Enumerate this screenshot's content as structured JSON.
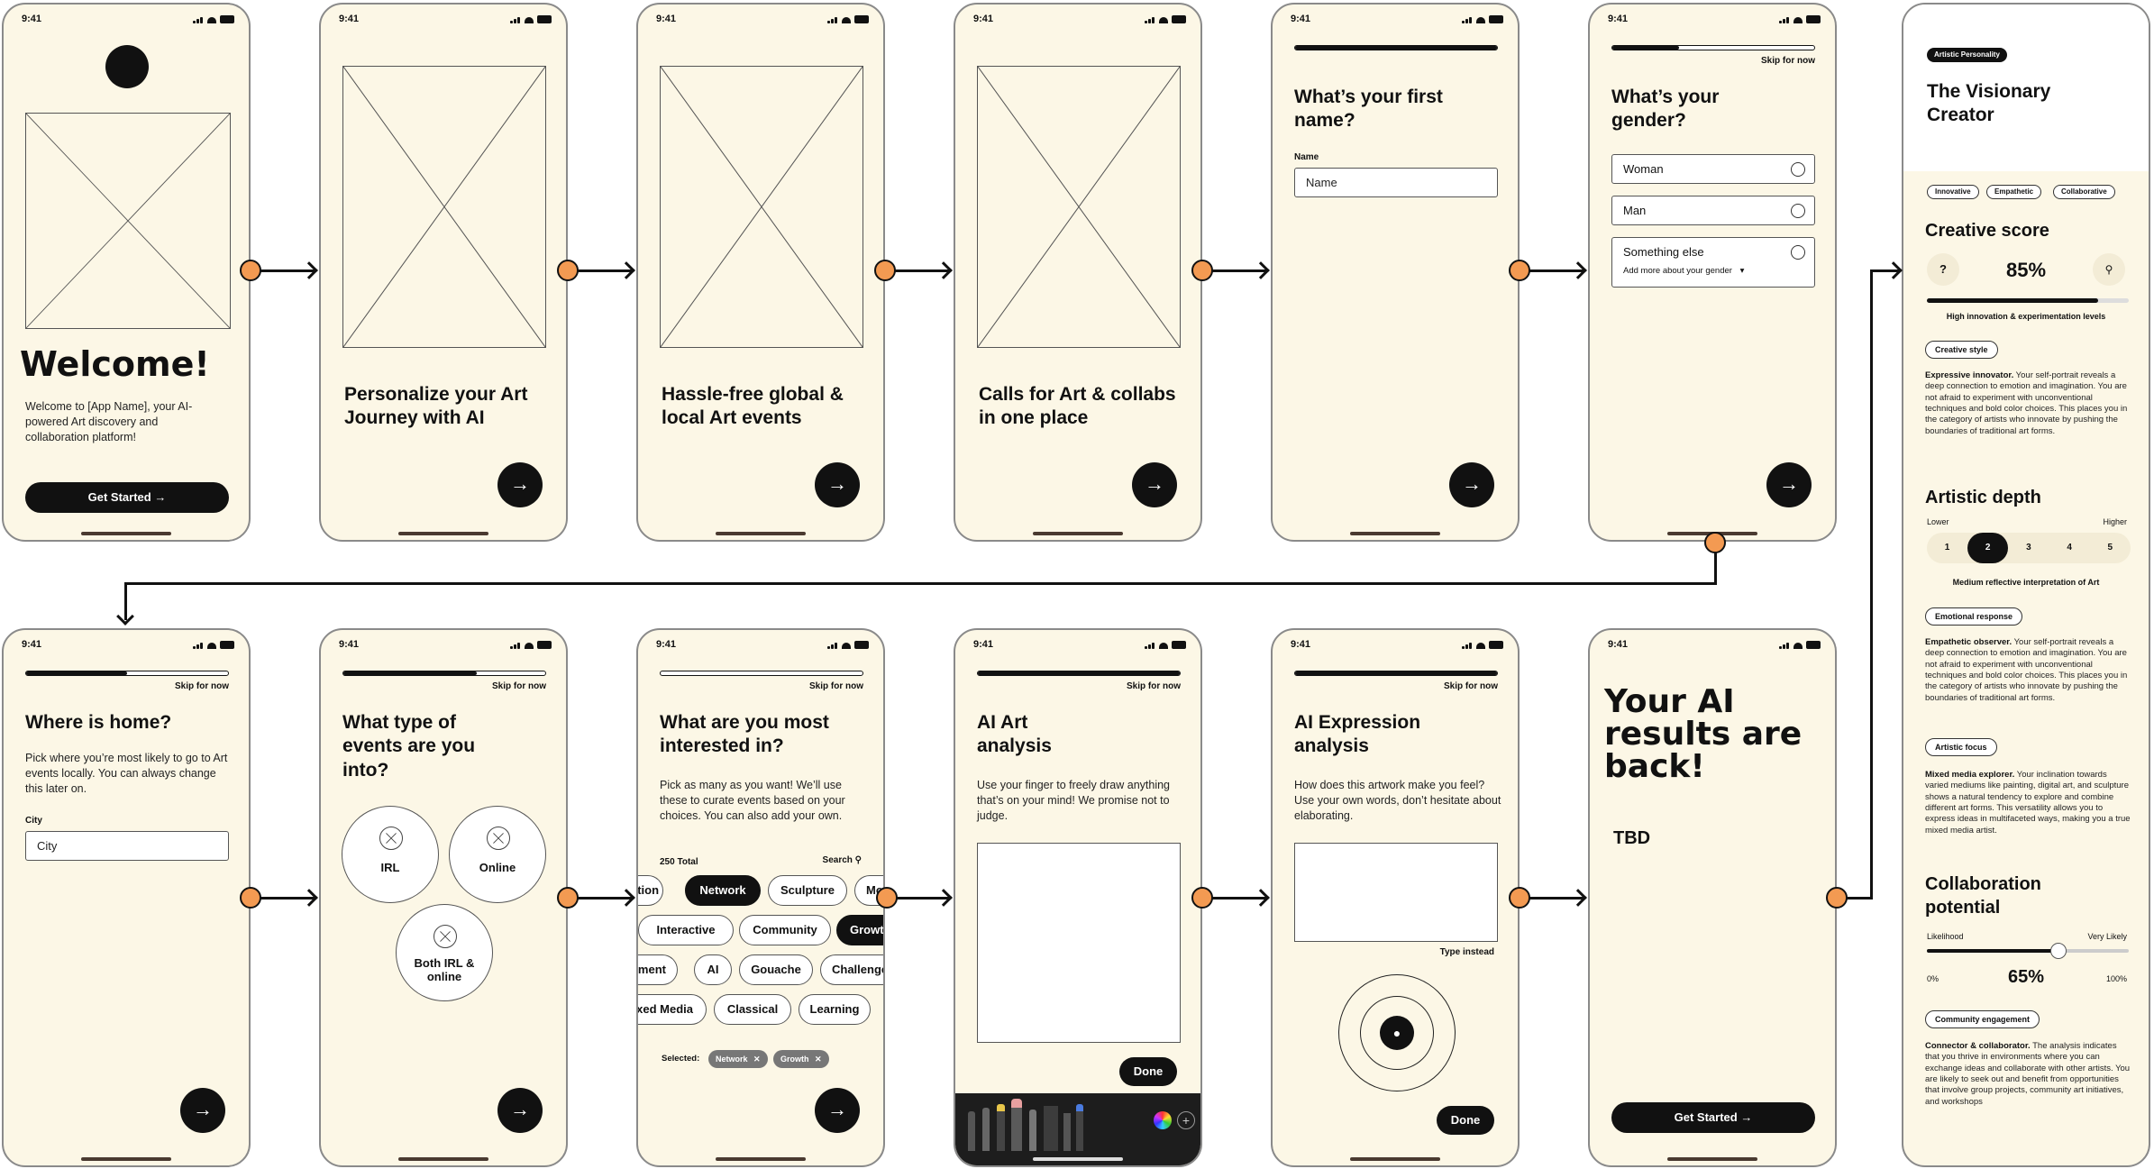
{
  "status": {
    "time": "9:41"
  },
  "welcome": {
    "title": "Welcome!",
    "body": "Welcome to [App Name], your AI-powered Art discovery and collaboration platform!",
    "cta": "Get Started"
  },
  "onboard": [
    {
      "title": "Personalize your Art Journey with AI"
    },
    {
      "title": "Hassle-free global & local Art events"
    },
    {
      "title": "Calls for Art & collabs in one place"
    }
  ],
  "name_screen": {
    "title": "What’s your first name?",
    "label": "Name",
    "placeholder": "Name"
  },
  "gender": {
    "title": "What’s your gender?",
    "skip": "Skip for now",
    "options": [
      "Woman",
      "Man",
      "Something else"
    ],
    "more": "Add more about your gender"
  },
  "home": {
    "title": "Where is home?",
    "skip": "Skip for now",
    "body": "Pick where you’re most likely to go to Art events locally. You can always change this later on.",
    "label": "City",
    "placeholder": "City"
  },
  "events": {
    "title": "What type of events are you into?",
    "skip": "Skip for now",
    "options": [
      "IRL",
      "Online",
      "Both IRL & online"
    ]
  },
  "interests": {
    "title": "What are you most interested in?",
    "skip": "Skip for now",
    "body": "Pick as many as you want! We’ll use these to curate events based on your choices. You can also add your own.",
    "total": "250 Total",
    "search": "Search",
    "chips": [
      "ation",
      "Network",
      "Sculpture",
      "Mo",
      "Interactive",
      "Community",
      "Growth",
      "ement",
      "AI",
      "Gouache",
      "Challenge",
      "xed Media",
      "Classical",
      "Learning"
    ],
    "selected_label": "Selected:",
    "selected": [
      "Network",
      "Growth"
    ]
  },
  "draw": {
    "title": "AI Art analysis",
    "skip": "Skip for now",
    "body": "Use your finger to freely draw anything that’s on your mind! We promise not to judge.",
    "done": "Done"
  },
  "expression": {
    "title": "AI Expression analysis",
    "skip": "Skip for now",
    "body": "How does this artwork make you feel? Use your own words, don’t hesitate about elaborating.",
    "type_instead": "Type instead",
    "done": "Done"
  },
  "results": {
    "title": "Your AI results are back!",
    "tbd": "TBD",
    "cta": "Get Started"
  },
  "profile": {
    "badge": "Artistic Personality",
    "name": "The Visionary Creator",
    "traits": [
      "Innovative",
      "Empathetic",
      "Collaborative"
    ],
    "score_title": "Creative score",
    "score": "85%",
    "score_fraction": 0.85,
    "score_note": "High innovation & experimentation levels",
    "q": "?",
    "style_tag": "Creative style",
    "style_lead": "Expressive innovator.",
    "style_text": " Your self-portrait reveals a deep connection to emotion and imagination. You are not afraid to experiment with unconventional techniques and bold color choices. This places you in the category of artists who innovate by pushing the boundaries of traditional art forms.",
    "depth_title": "Artistic depth",
    "depth_low": "Lower",
    "depth_high": "Higher",
    "depth_levels": [
      "1",
      "2",
      "3",
      "4",
      "5"
    ],
    "depth_selected": 2,
    "depth_note": "Medium reflective interpretation of Art",
    "emo_tag": "Emotional response",
    "emo_lead": "Empathetic observer.",
    "emo_text": " Your self-portrait reveals a deep connection to emotion and imagination. You are not afraid to experiment with unconventional techniques and bold color choices. This places you in the category of artists who innovate by pushing the boundaries of traditional art forms.",
    "focus_tag": "Artistic focus",
    "focus_lead": "Mixed media explorer.",
    "focus_text": " Your inclination towards varied mediums like painting, digital art, and sculpture shows a natural tendency to explore and combine different art forms. This versatility allows you to express ideas in multifaceted ways, making you a true mixed media artist.",
    "collab_title": "Collaboration potential",
    "collab_low": "Likelihood",
    "collab_high": "Very Likely",
    "collab_min": "0%",
    "collab_max": "100%",
    "collab": "65%",
    "collab_fraction": 0.65,
    "comm_tag": "Community engagement",
    "comm_lead": "Connector & collaborator.",
    "comm_text": " The analysis indicates that you thrive in environments where you can exchange ideas and collaborate with other artists. You are likely to seek out and benefit from opportunities that involve group projects, community art initiatives, and workshops"
  },
  "colors": {
    "bg": "#fcf7e6",
    "accent": "#f39a52",
    "ink": "#111111"
  }
}
